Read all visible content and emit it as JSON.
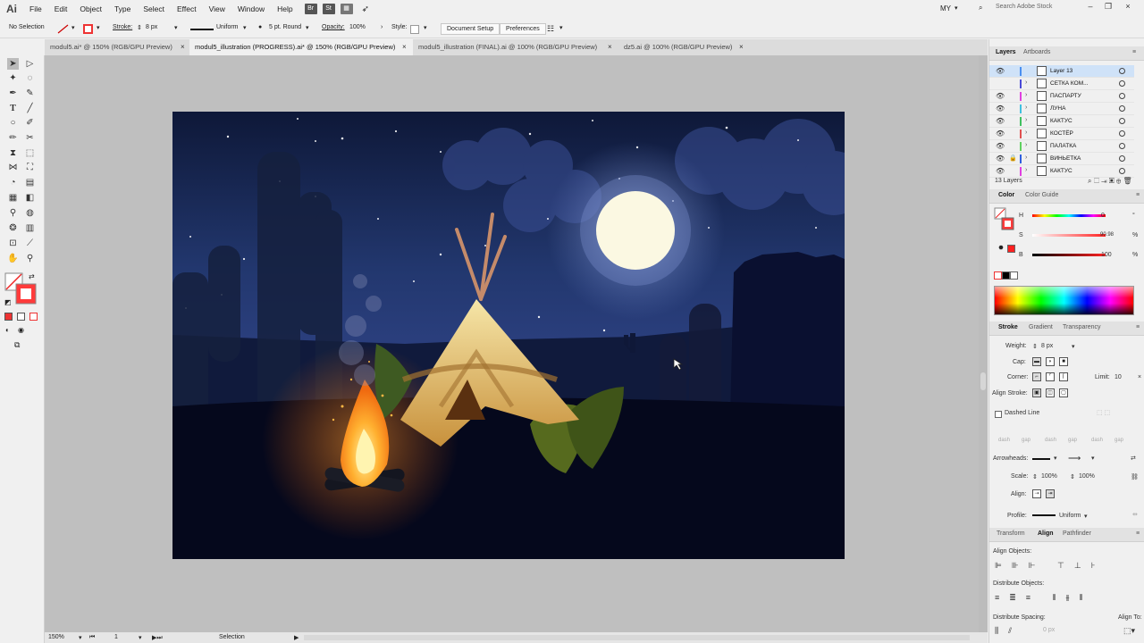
{
  "app": {
    "logo": "Ai"
  },
  "menu": [
    "File",
    "Edit",
    "Object",
    "Type",
    "Select",
    "Effect",
    "View",
    "Window",
    "Help"
  ],
  "menubar_icons": [
    "Br",
    "St"
  ],
  "workspace": "MY",
  "stock_search_placeholder": "Search Adobe Stock",
  "control": {
    "selection": "No Selection",
    "stroke_label": "Stroke:",
    "stroke_value": "8 px",
    "uniform": "Uniform",
    "brush": "5 pt. Round",
    "opacity_label": "Opacity:",
    "opacity_value": "100%",
    "style_label": "Style:",
    "doc_setup": "Document Setup",
    "preferences": "Preferences"
  },
  "tabs": [
    {
      "label": "modul5.ai* @ 150% (RGB/GPU Preview)"
    },
    {
      "label": "modul5_illustration (PROGRESS).ai* @ 150% (RGB/GPU Preview)"
    },
    {
      "label": "modul5_illustration (FINAL).ai @ 100% (RGB/GPU Preview)"
    },
    {
      "label": "dz5.ai @ 100% (RGB/GPU Preview)"
    }
  ],
  "tab_close": "×",
  "status": {
    "zoom": "150%",
    "artboard": "1",
    "tool": "Selection"
  },
  "layers_panel": {
    "tabs": [
      "Layers",
      "Artboards"
    ],
    "layers": [
      {
        "name": "Layer 13",
        "color": "#4a8ff0"
      },
      {
        "name": "СЕТКА КОМ...",
        "color": "#4a4ad8"
      },
      {
        "name": "ПАСПАРТУ",
        "color": "#e040e0"
      },
      {
        "name": "ЛУНА",
        "color": "#40c0e0"
      },
      {
        "name": "КАКТУС",
        "color": "#40c060"
      },
      {
        "name": "КОСТЁР",
        "color": "#e05050"
      },
      {
        "name": "ПАЛАТКА",
        "color": "#60d060"
      },
      {
        "name": "ВИНЬЕТКА",
        "color": "#3060e0"
      },
      {
        "name": "КАКТУС",
        "color": "#e040e0"
      }
    ],
    "count": "13 Layers"
  },
  "color_panel": {
    "tabs": [
      "Color",
      "Color Guide"
    ],
    "h_label": "H",
    "h_value": "0",
    "s_label": "S",
    "s_value": "90.98",
    "b_label": "B",
    "b_value": "100",
    "h_unit": "°",
    "pct": "%"
  },
  "stroke_panel": {
    "tabs": [
      "Stroke",
      "Gradient",
      "Transparency"
    ],
    "weight_label": "Weight:",
    "weight_value": "8 px",
    "cap_label": "Cap:",
    "corner_label": "Corner:",
    "limit_label": "Limit:",
    "limit_value": "10",
    "align_label": "Align Stroke:",
    "dashed_label": "Dashed Line",
    "dash_labels": [
      "dash",
      "gap",
      "dash",
      "gap",
      "dash",
      "gap"
    ],
    "arrowheads_label": "Arrowheads:",
    "scale_label": "Scale:",
    "scale_a": "100%",
    "scale_b": "100%",
    "align2_label": "Align:",
    "profile_label": "Profile:",
    "profile_value": "Uniform"
  },
  "align_panel": {
    "tabs": [
      "Transform",
      "Align",
      "Pathfinder"
    ],
    "align_objects": "Align Objects:",
    "distribute_objects": "Distribute Objects:",
    "distribute_spacing": "Distribute Spacing:",
    "align_to": "Align To:",
    "spacing_value": "0 px"
  },
  "colors": {
    "fill": "#ff3b3b",
    "accent_blue": "#4a8ff0",
    "sky_top": "#0e1838",
    "moon": "#fbf8e2"
  }
}
